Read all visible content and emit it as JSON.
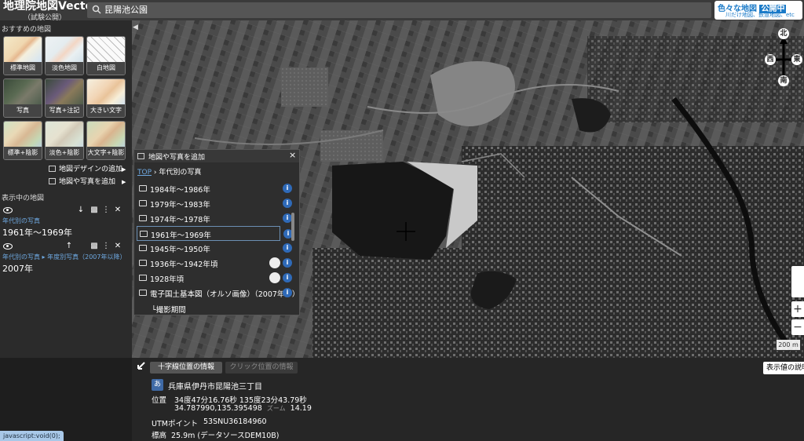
{
  "header": {
    "title": "地理院地図Vector",
    "subtitle": "（試験公開）",
    "search": {
      "value": "昆陽池公園"
    },
    "promo": {
      "prefix": "色々な地図 ",
      "highlight": "公開中",
      "sub": "川だけ地図、鉄道地図、etc"
    }
  },
  "sidebar": {
    "recommended_title": "おすすめの地図",
    "maps": [
      {
        "label": "標準地図"
      },
      {
        "label": "淡色地図"
      },
      {
        "label": "白地図"
      },
      {
        "label": "写真"
      },
      {
        "label": "写真+注記"
      },
      {
        "label": "大きい文字"
      },
      {
        "label": "標準+陰影"
      },
      {
        "label": "淡色+陰影"
      },
      {
        "label": "大文字+陰影"
      }
    ],
    "design_link": "地図デザインの追加",
    "add_link": "地図や写真を追加",
    "displayed_title": "表示中の地図",
    "layers": [
      {
        "category": "年代別の写真",
        "name": "1961年〜1969年"
      },
      {
        "category": "年代別の写真 ▸ 年度別写真（2007年以降）",
        "name": "2007年"
      }
    ]
  },
  "popup": {
    "title": "地図や写真を追加",
    "close": "×",
    "crumb_top": "TOP",
    "crumb_sep": " ›  ",
    "crumb_current": "年代別の写真",
    "items": [
      {
        "label": "1984年〜1986年"
      },
      {
        "label": "1979年〜1983年"
      },
      {
        "label": "1974年〜1978年"
      },
      {
        "label": "1961年〜1969年"
      },
      {
        "label": "1945年〜1950年"
      },
      {
        "label": "1936年〜1942年頃"
      },
      {
        "label": "1928年頃"
      },
      {
        "label": "電子国土基本図（オルソ画像）（2007年〜）"
      }
    ],
    "sub_item": "└撮影期間",
    "info_glyph": "i"
  },
  "map": {
    "compass": {
      "n": "北",
      "s": "南",
      "e": "東",
      "w": "西"
    },
    "zoom_in": "+",
    "zoom_out": "−",
    "scale": "200 m",
    "collapse": "◀"
  },
  "info": {
    "tab_crosshair": "十字線位置の情報",
    "tab_click": "クリック位置の情報",
    "help": "表示値の説明",
    "address_badge": "あ",
    "address": "兵庫県伊丹市昆陽池三丁目",
    "position_label": "位置",
    "position_dms": "34度47分16.76秒 135度23分43.79秒",
    "position_dec": "34.787990,135.395498",
    "zoom_label": "ズーム",
    "zoom_value": "14.19",
    "utm_label": "UTMポイント",
    "utm_value": "53SNU36184960",
    "elev_label": "標高",
    "elev_value": "25.9m (データソースDEM10B)"
  },
  "status": "javascript:void(0);"
}
